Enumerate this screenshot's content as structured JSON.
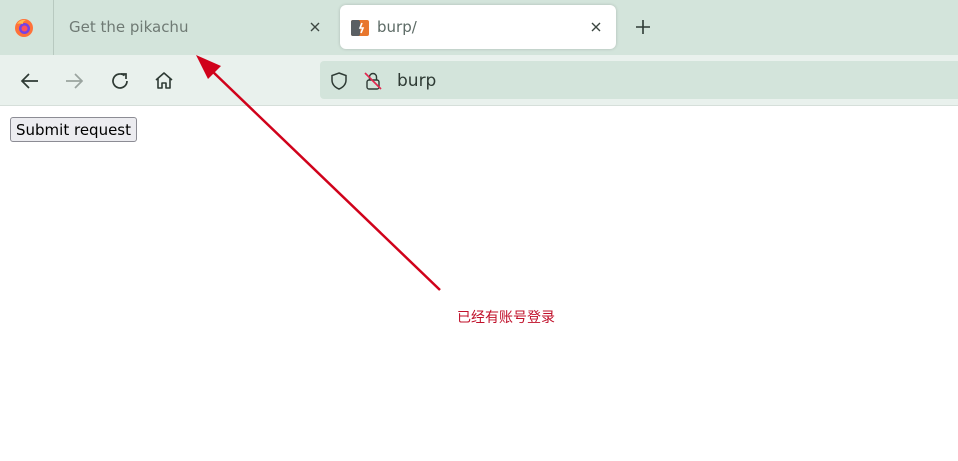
{
  "tabs": [
    {
      "title": "Get the pikachu",
      "active": false
    },
    {
      "title": "burp/",
      "active": true
    }
  ],
  "urlbar": {
    "url": "burp"
  },
  "page": {
    "submit_label": "Submit request"
  },
  "annotation": {
    "text": "已经有账号登录",
    "color": "#c0102a"
  },
  "colors": {
    "tabstrip": "#d3e4db",
    "navbar": "#e9f1ed",
    "accent_red": "#d0021b"
  }
}
